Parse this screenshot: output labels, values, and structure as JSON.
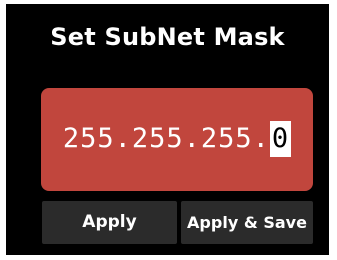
{
  "title": "Set SubNet Mask",
  "subnet": {
    "prefix": "255.255.255.",
    "cursor_digit": "0"
  },
  "buttons": {
    "apply": "Apply",
    "apply_save": "Apply & Save"
  },
  "colors": {
    "screen_bg": "#000000",
    "input_bg": "#c1463d",
    "button_bg": "#2b2b2b",
    "text": "#ffffff",
    "cursor_bg": "#ffffff",
    "cursor_text": "#000000"
  }
}
